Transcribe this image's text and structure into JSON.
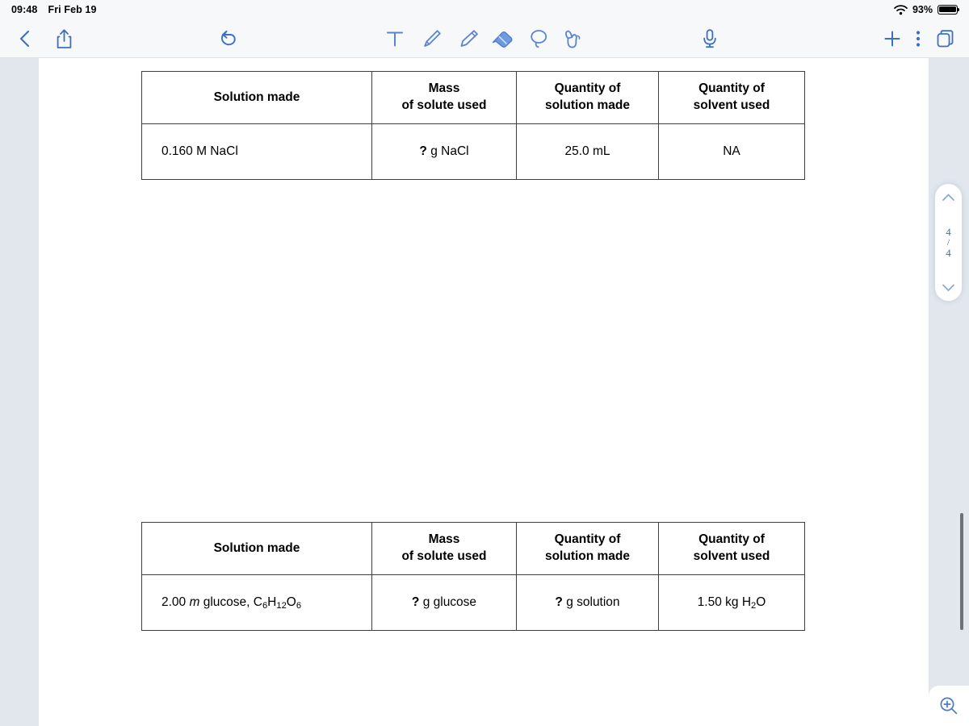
{
  "status_bar": {
    "time": "09:48",
    "date": "Fri Feb 19",
    "wifi_icon": "wifi-icon",
    "battery_percent": "93%",
    "battery_icon": "battery-full-icon"
  },
  "toolbar": {
    "back_icon": "chevron-left-icon",
    "share_icon": "share-icon",
    "undo_icon": "undo-arrow-icon",
    "tools": [
      {
        "name": "text-tool",
        "icon": "text-t-icon",
        "selected": false
      },
      {
        "name": "pen-tool",
        "icon": "pen-icon",
        "selected": false
      },
      {
        "name": "highlighter-tool",
        "icon": "highlighter-icon",
        "selected": false
      },
      {
        "name": "eraser-tool",
        "icon": "eraser-icon",
        "selected": true
      },
      {
        "name": "lasso-tool",
        "icon": "lasso-icon",
        "selected": false
      },
      {
        "name": "hand-tool",
        "icon": "hand-pointer-icon",
        "selected": false
      }
    ],
    "mic_icon": "microphone-icon",
    "add_icon": "plus-icon",
    "more_icon": "three-dots-vertical-icon",
    "pages_icon": "pages-stack-icon"
  },
  "page_nav": {
    "up_icon": "chevron-up-icon",
    "current_page": "4",
    "separator": "/",
    "total_pages": "4",
    "down_icon": "chevron-down-icon"
  },
  "zoom_control": {
    "icon": "magnifier-plus-icon"
  },
  "document": {
    "tables": [
      {
        "name": "solution-table-1",
        "headers": [
          {
            "line1": "Solution made",
            "line2": ""
          },
          {
            "line1": "Mass",
            "line2": "of solute used"
          },
          {
            "line1": "Quantity of",
            "line2": "solution made"
          },
          {
            "line1": "Quantity of",
            "line2": "solvent used"
          }
        ],
        "rows": [
          {
            "solution_made": "0.160 M NaCl",
            "mass_of_solute_q": "?",
            "mass_of_solute_rest": " g NaCl",
            "quantity_of_solution": "25.0 mL",
            "quantity_of_solvent": "NA"
          }
        ]
      },
      {
        "name": "solution-table-2",
        "headers": [
          {
            "line1": "Solution made",
            "line2": ""
          },
          {
            "line1": "Mass",
            "line2": "of solute used"
          },
          {
            "line1": "Quantity of",
            "line2": "solution made"
          },
          {
            "line1": "Quantity of",
            "line2": "solvent used"
          }
        ],
        "rows": [
          {
            "solution_made_num": "2.00 ",
            "solution_made_italic": "m",
            "solution_made_rest": " glucose, C",
            "formula_sub1": "6",
            "formula_h": "H",
            "formula_sub2": "12",
            "formula_o": "O",
            "formula_sub3": "6",
            "mass_of_solute_q": "?",
            "mass_of_solute_rest": " g glucose",
            "quantity_of_solution_q": "?",
            "quantity_of_solution_rest": " g solution",
            "quantity_of_solvent_num": "1.50 kg H",
            "quantity_of_solvent_sub": "2",
            "quantity_of_solvent_end": "O"
          }
        ]
      }
    ]
  },
  "colors": {
    "accent_blue": "#3b6fc4",
    "toolbar_bg": "#f7f8fa",
    "sidebar_bg": "#e2e7ee",
    "table_border": "#3f3f3f"
  }
}
